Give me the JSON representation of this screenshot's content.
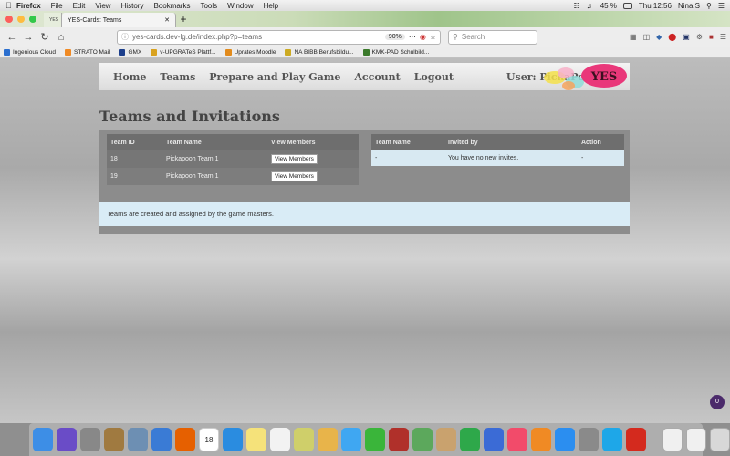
{
  "menubar": {
    "items": [
      "Firefox",
      "File",
      "Edit",
      "View",
      "History",
      "Bookmarks",
      "Tools",
      "Window",
      "Help"
    ],
    "battery": "45 %",
    "clock": "Thu 12:56",
    "user": "Nina S"
  },
  "browser": {
    "tabs": [
      {
        "label": "",
        "icon": "yes-favicon"
      },
      {
        "label": "YES-Cards: Teams"
      }
    ],
    "url": "yes-cards.dev-lg.de/index.php?p=teams",
    "zoom": "90%",
    "search_placeholder": "Search",
    "bookmarks": [
      {
        "label": "Ingenious Cloud",
        "color": "#2b6fcf"
      },
      {
        "label": "STRATO Mail",
        "color": "#f08a24"
      },
      {
        "label": "GMX",
        "color": "#1c3f8c"
      },
      {
        "label": "v-UPGRATeS Plattf...",
        "color": "#d9a21f"
      },
      {
        "label": "Uprates Moodle",
        "color": "#e28b1c"
      },
      {
        "label": "NA BIBB Berufsbildu...",
        "color": "#ccaa22"
      },
      {
        "label": "KMK-PAD Schulbild...",
        "color": "#3b7a2b"
      }
    ]
  },
  "site": {
    "nav": [
      "Home",
      "Teams",
      "Prepare and Play Game",
      "Account",
      "Logout"
    ],
    "user_label": "User: PickaPo...",
    "logo_text": "YES",
    "heading": "Teams and Invitations"
  },
  "teams_table": {
    "headers": [
      "Team ID",
      "Team Name",
      "View Members"
    ],
    "rows": [
      {
        "id": "18",
        "name": "Pickapooh Team 1",
        "button": "View Members"
      },
      {
        "id": "19",
        "name": "Pickapooh Team 1",
        "button": "View Members"
      }
    ]
  },
  "invites_table": {
    "headers": [
      "Team Name",
      "Invited by",
      "Action"
    ],
    "rows": [
      {
        "team": "-",
        "invited_by": "You have no new invites.",
        "action": "-"
      }
    ]
  },
  "info_text": "Teams are created and assigned by the game masters.",
  "chat_badge": "0",
  "dock": {
    "calendar_day": "18",
    "apps": [
      {
        "name": "finder",
        "color": "#3d8ee6"
      },
      {
        "name": "siri",
        "color": "#6a4cc7"
      },
      {
        "name": "launchpad",
        "color": "#888888"
      },
      {
        "name": "notes-app",
        "color": "#a07a40"
      },
      {
        "name": "preview",
        "color": "#6d8fb3"
      },
      {
        "name": "finder2",
        "color": "#3a7bd5"
      },
      {
        "name": "firefox",
        "color": "#e66000"
      },
      {
        "name": "calendar",
        "color": "#ffffff"
      },
      {
        "name": "safari",
        "color": "#2a8ce0"
      },
      {
        "name": "notes",
        "color": "#f5e27a"
      },
      {
        "name": "reminders",
        "color": "#f2f2f2"
      },
      {
        "name": "stickies",
        "color": "#cfcf6a"
      },
      {
        "name": "photos",
        "color": "#e8b44a"
      },
      {
        "name": "messages",
        "color": "#3fa7f2"
      },
      {
        "name": "facetime",
        "color": "#3ab53a"
      },
      {
        "name": "photo-booth",
        "color": "#b0302a"
      },
      {
        "name": "maps",
        "color": "#5ca85c"
      },
      {
        "name": "contacts",
        "color": "#c9a26e"
      },
      {
        "name": "numbers",
        "color": "#2ea84a"
      },
      {
        "name": "keynote",
        "color": "#3b6bd6"
      },
      {
        "name": "music",
        "color": "#f24b6a"
      },
      {
        "name": "books",
        "color": "#f08a24"
      },
      {
        "name": "app-store",
        "color": "#2b8ef0"
      },
      {
        "name": "system-preferences",
        "color": "#8a8a8a"
      },
      {
        "name": "skype",
        "color": "#1ea7e8"
      },
      {
        "name": "acrobat",
        "color": "#d42a1e"
      },
      {
        "name": "document",
        "color": "#f0f0f0"
      },
      {
        "name": "document2",
        "color": "#f0f0f0"
      },
      {
        "name": "trash",
        "color": "#d8d8d8"
      }
    ]
  }
}
